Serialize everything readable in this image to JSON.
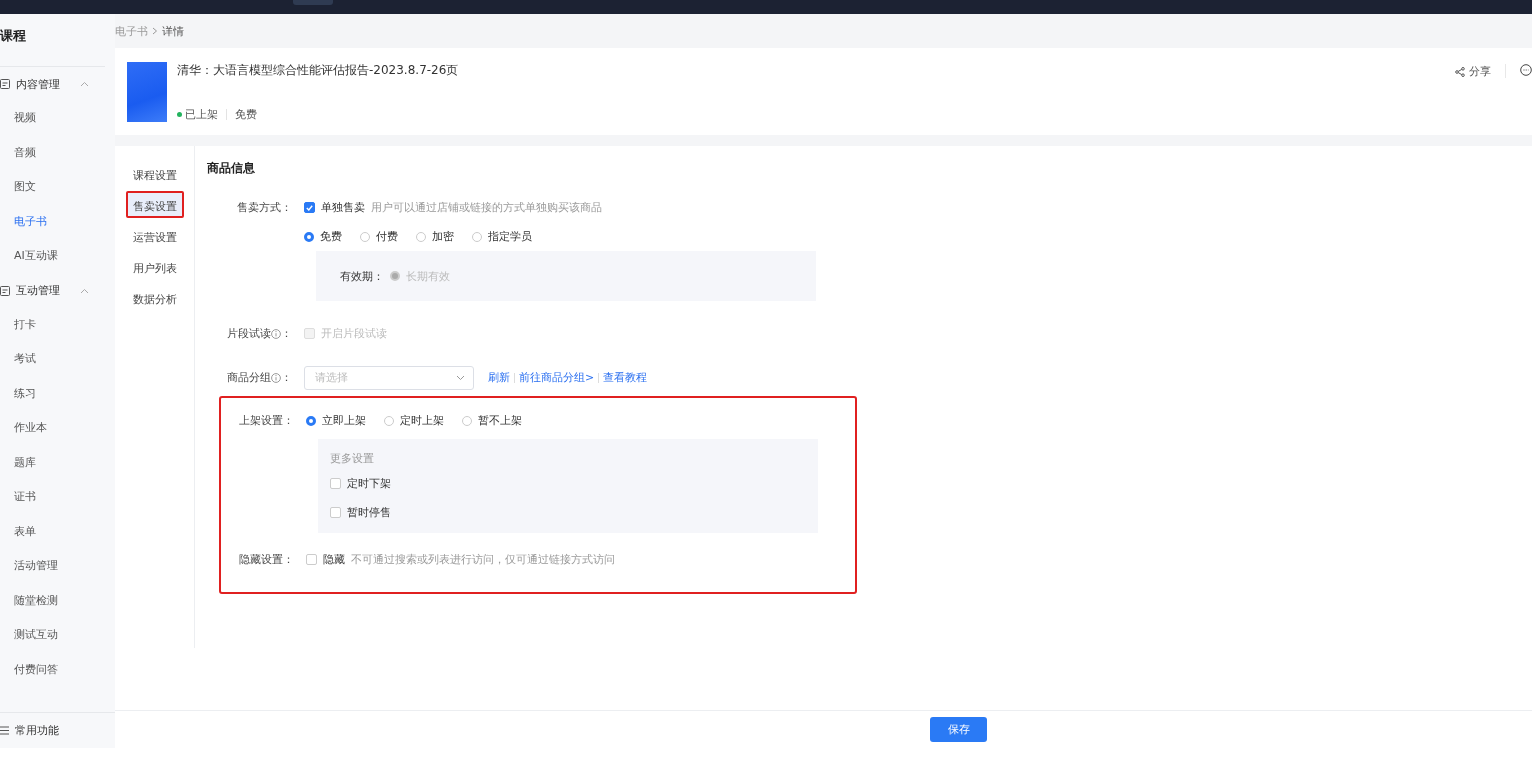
{
  "sidebar": {
    "title": "课程",
    "groups": [
      {
        "label": "内容管理",
        "expanded": true,
        "items": [
          {
            "label": "视频",
            "selected": false
          },
          {
            "label": "音频",
            "selected": false
          },
          {
            "label": "图文",
            "selected": false
          },
          {
            "label": "电子书",
            "selected": true
          },
          {
            "label": "AI互动课",
            "selected": false
          }
        ]
      },
      {
        "label": "互动管理",
        "expanded": true,
        "items": [
          {
            "label": "打卡",
            "selected": false
          },
          {
            "label": "考试",
            "selected": false
          },
          {
            "label": "练习",
            "selected": false
          },
          {
            "label": "作业本",
            "selected": false
          },
          {
            "label": "题库",
            "selected": false
          },
          {
            "label": "证书",
            "selected": false
          },
          {
            "label": "表单",
            "selected": false
          },
          {
            "label": "活动管理",
            "selected": false
          },
          {
            "label": "随堂检测",
            "selected": false
          },
          {
            "label": "测试互动",
            "selected": false
          },
          {
            "label": "付费问答",
            "selected": false
          }
        ]
      }
    ],
    "footer": "常用功能"
  },
  "breadcrumb": [
    "电子书",
    "详情"
  ],
  "header": {
    "title": "清华：大语言模型综合性能评估报告-2023.8.7-26页",
    "status": {
      "label": "已上架",
      "color": "#22b35e"
    },
    "price": "免费",
    "share": "分享"
  },
  "subnav": [
    {
      "label": "课程设置",
      "selected": false,
      "highlighted": false
    },
    {
      "label": "售卖设置",
      "selected": true,
      "highlighted": true
    },
    {
      "label": "运营设置",
      "selected": false,
      "highlighted": false
    },
    {
      "label": "用户列表",
      "selected": false,
      "highlighted": false
    },
    {
      "label": "数据分析",
      "selected": false,
      "highlighted": false
    }
  ],
  "form": {
    "title": "商品信息",
    "sale_mode": {
      "label": "售卖方式：",
      "checkbox": {
        "label": "单独售卖",
        "checked": true,
        "hint": "用户可以通过店铺或链接的方式单独购买该商品"
      },
      "options": [
        {
          "label": "免费",
          "selected": true
        },
        {
          "label": "付费",
          "selected": false
        },
        {
          "label": "加密",
          "selected": false
        },
        {
          "label": "指定学员",
          "selected": false
        }
      ],
      "validity": {
        "label": "有效期：",
        "option": {
          "label": "长期有效",
          "selected": true,
          "disabled": true
        }
      }
    },
    "trial": {
      "label": "片段试读",
      "suffix": "：",
      "checkbox": {
        "label": "开启片段试读",
        "checked": false,
        "disabled": true
      }
    },
    "group": {
      "label": "商品分组",
      "suffix": "：",
      "placeholder": "请选择",
      "links": [
        "刷新",
        "前往商品分组>",
        "查看教程"
      ]
    },
    "highlighted": true,
    "listing": {
      "label": "上架设置：",
      "options": [
        {
          "label": "立即上架",
          "selected": true
        },
        {
          "label": "定时上架",
          "selected": false
        },
        {
          "label": "暂不上架",
          "selected": false
        }
      ],
      "more": {
        "title": "更多设置",
        "items": [
          {
            "label": "定时下架",
            "checked": false
          },
          {
            "label": "暂时停售",
            "checked": false
          }
        ]
      }
    },
    "hidden": {
      "label": "隐藏设置：",
      "checkbox": {
        "label": "隐藏",
        "checked": false,
        "hint": "不可通过搜索或列表进行访问，仅可通过链接方式访问"
      }
    }
  },
  "save": "保存"
}
